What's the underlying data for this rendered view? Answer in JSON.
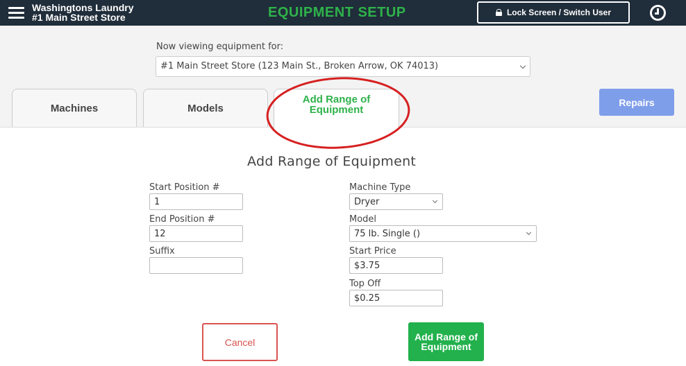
{
  "header": {
    "store_line1": "Washingtons Laundry",
    "store_line2": "#1 Main Street Store",
    "title": "EQUIPMENT SETUP",
    "lock_label": "Lock Screen / Switch User"
  },
  "location": {
    "label": "Now viewing equipment for:",
    "selected": "#1 Main Street Store (123 Main St., Broken Arrow, OK 74013)"
  },
  "tabs": [
    {
      "label": "Machines"
    },
    {
      "label": "Models"
    },
    {
      "label_line1": "Add Range of",
      "label_line2": "Equipment",
      "active": true
    }
  ],
  "repairs_label": "Repairs",
  "form": {
    "title": "Add Range of Equipment",
    "start_position": {
      "label": "Start Position #",
      "value": "1"
    },
    "end_position": {
      "label": "End Position #",
      "value": "12"
    },
    "suffix": {
      "label": "Suffix",
      "value": ""
    },
    "machine_type": {
      "label": "Machine Type",
      "value": "Dryer"
    },
    "model": {
      "label": "Model",
      "value": "75 lb. Single ()"
    },
    "start_price": {
      "label": "Start Price",
      "value": "$3.75"
    },
    "top_off": {
      "label": "Top Off",
      "value": "$0.25"
    },
    "cancel_label": "Cancel",
    "submit_line1": "Add Range of",
    "submit_line2": "Equipment"
  },
  "colors": {
    "topbar": "#202d3a",
    "brand_green": "#2eb24a",
    "repairs_blue": "#7f9eea",
    "cancel_red": "#d9534f",
    "annotation_red": "#d62020"
  }
}
